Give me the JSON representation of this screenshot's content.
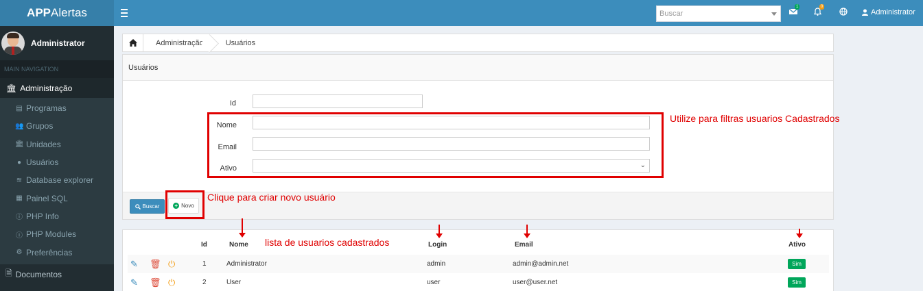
{
  "app": {
    "logo_bold": "APP",
    "logo_rest": "Alertas",
    "search_placeholder": "Buscar",
    "mail_badge": "1",
    "bell_badge": "0",
    "user_label": "Administrator",
    "colors": {
      "navbar": "#3c8dbc",
      "logo": "#367fa9",
      "sidebar": "#222d32",
      "badge_mail": "#00a65a",
      "badge_bell": "#f39c12"
    }
  },
  "sidebar": {
    "user_name": "Administrator",
    "nav_header": "MAIN NAVIGATION",
    "section": {
      "label": "Administração",
      "icon": "bank-icon"
    },
    "items": [
      {
        "label": "Programas",
        "icon": "file-icon"
      },
      {
        "label": "Grupos",
        "icon": "users-icon"
      },
      {
        "label": "Unidades",
        "icon": "bank-icon"
      },
      {
        "label": "Usuários",
        "icon": "user-icon"
      },
      {
        "label": "Database explorer",
        "icon": "database-icon"
      },
      {
        "label": "Painel SQL",
        "icon": "table-icon"
      },
      {
        "label": "PHP Info",
        "icon": "info-icon"
      },
      {
        "label": "PHP Modules",
        "icon": "info-icon"
      },
      {
        "label": "Preferências",
        "icon": "gear-icon"
      }
    ],
    "documents": {
      "label": "Documentos",
      "icon": "document-icon"
    }
  },
  "breadcrumb": [
    "Administração",
    "Usuários"
  ],
  "form": {
    "title": "Usuários",
    "labels": {
      "id": "Id",
      "nome": "Nome",
      "email": "Email",
      "ativo": "Ativo"
    },
    "values": {
      "id": "",
      "nome": "",
      "email": "",
      "ativo": ""
    },
    "buttons": {
      "buscar": "Buscar",
      "novo": "Novo"
    }
  },
  "table": {
    "headers": {
      "id": "Id",
      "nome": "Nome",
      "login": "Login",
      "email": "Email",
      "ativo": "Ativo"
    },
    "rows": [
      {
        "id": "1",
        "nome": "Administrator",
        "login": "admin",
        "email": "admin@admin.net",
        "ativo": "Sim"
      },
      {
        "id": "2",
        "nome": "User",
        "login": "user",
        "email": "user@user.net",
        "ativo": "Sim"
      }
    ]
  },
  "annotations": {
    "filters": "Utilize para filtras usuarios Cadastrados",
    "new": "Clique para criar novo usuário",
    "list": "lista de usuarios cadastrados",
    "color": "#e00000"
  }
}
